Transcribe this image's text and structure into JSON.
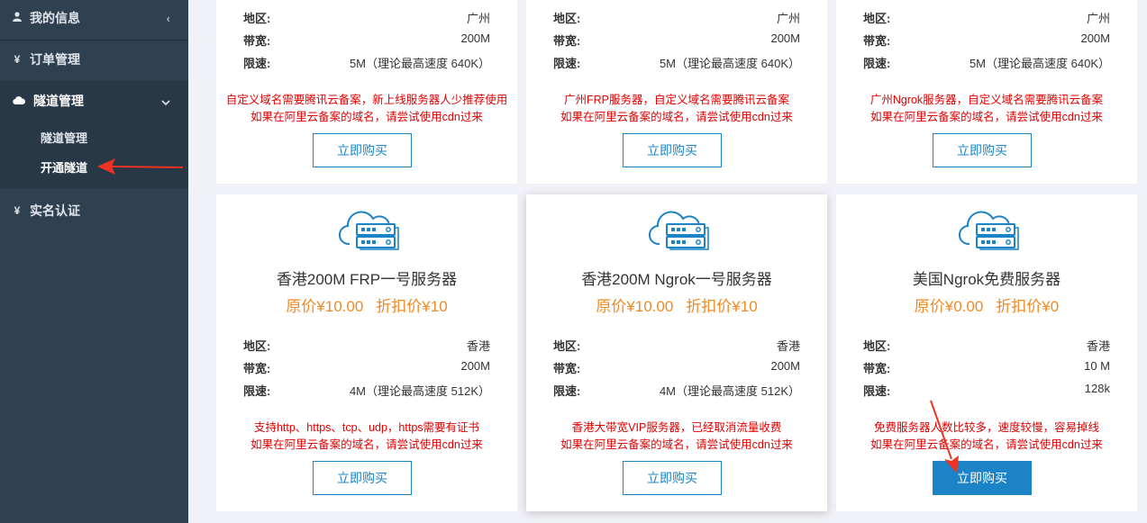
{
  "sidebar": {
    "items": [
      {
        "label": "我的信息",
        "icon": "user-icon",
        "caret": "‹"
      },
      {
        "label": "订单管理",
        "icon": "yen-icon"
      },
      {
        "label": "隧道管理",
        "icon": "cloud-icon",
        "caret": "⌄"
      },
      {
        "label": "实名认证",
        "icon": "yen-icon"
      }
    ],
    "submenu": [
      "隧道管理",
      "开通隧道"
    ]
  },
  "labels": {
    "region": "地区:",
    "bandwidth": "带宽:",
    "speed": "限速:"
  },
  "buy_label": "立即购买",
  "top_cards": [
    {
      "region": "广州",
      "bandwidth": "200M",
      "speed": "5M（理论最高速度 640K）",
      "note1": "自定义域名需要腾讯云备案，新上线服务器人少推荐使用",
      "note2": "如果在阿里云备案的域名，请尝试使用cdn过来"
    },
    {
      "region": "广州",
      "bandwidth": "200M",
      "speed": "5M（理论最高速度 640K）",
      "note1": "广州FRP服务器，自定义域名需要腾讯云备案",
      "note2": "如果在阿里云备案的域名，请尝试使用cdn过来"
    },
    {
      "region": "广州",
      "bandwidth": "200M",
      "speed": "5M（理论最高速度 640K）",
      "note1": "广州Ngrok服务器，自定义域名需要腾讯云备案",
      "note2": "如果在阿里云备案的域名，请尝试使用cdn过来"
    }
  ],
  "bottom_cards": [
    {
      "title": "香港200M FRP一号服务器",
      "orig_price": "原价¥10.00",
      "disc_price": "折扣价¥10",
      "region": "香港",
      "bandwidth": "200M",
      "speed": "4M（理论最高速度 512K）",
      "note1": "支持http、https、tcp、udp，https需要有证书",
      "note2": "如果在阿里云备案的域名，请尝试使用cdn过来"
    },
    {
      "title": "香港200M Ngrok一号服务器",
      "orig_price": "原价¥10.00",
      "disc_price": "折扣价¥10",
      "region": "香港",
      "bandwidth": "200M",
      "speed": "4M（理论最高速度 512K）",
      "note1": "香港大带宽VIP服务器，已经取消流量收费",
      "note2": "如果在阿里云备案的域名，请尝试使用cdn过来"
    },
    {
      "title": "美国Ngrok免费服务器",
      "orig_price": "原价¥0.00",
      "disc_price": "折扣价¥0",
      "region": "香港",
      "bandwidth": "10 M",
      "speed": "128k",
      "note1": "免费服务器人数比较多，速度较慢，容易掉线",
      "note2": "如果在阿里云备案的域名，请尝试使用cdn过来"
    }
  ],
  "colors": {
    "sidebar": "#2f4050",
    "accent": "#1c84c6",
    "price": "#f08a24",
    "note": "#e00000",
    "annotation_arrow": "#ee3322"
  }
}
